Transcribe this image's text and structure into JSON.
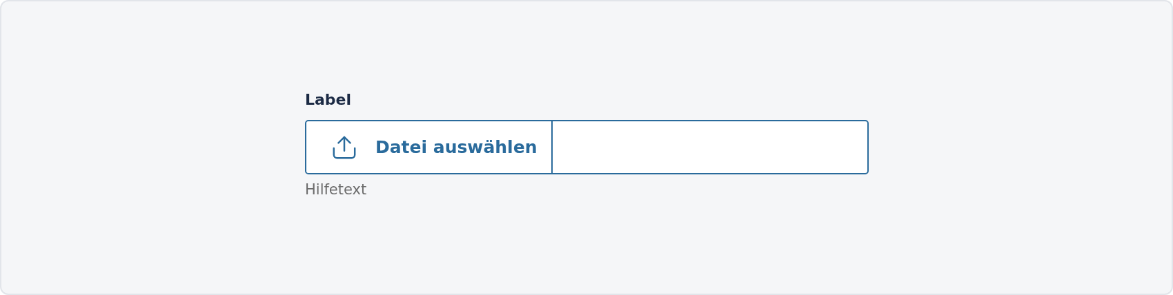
{
  "file_upload": {
    "label": "Label",
    "button": "Datei auswählen",
    "hint": "Hilfetext"
  }
}
